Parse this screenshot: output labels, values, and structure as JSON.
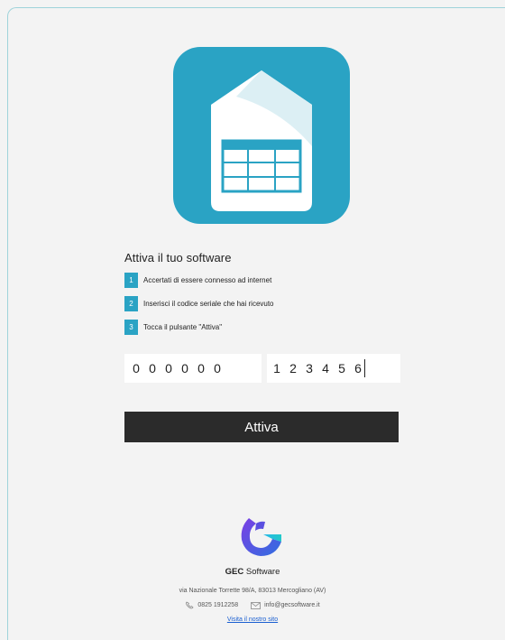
{
  "activation": {
    "title": "Attiva il tuo software",
    "steps": [
      {
        "number": "1",
        "text": "Accertati di essere connesso ad internet"
      },
      {
        "number": "2",
        "text": "Inserisci il codice seriale che hai ricevuto"
      },
      {
        "number": "3",
        "text": "Tocca il pulsante \"Attiva\""
      }
    ],
    "serial_first": [
      "0",
      "0",
      "0",
      "0",
      "0",
      "0"
    ],
    "serial_second": [
      "1",
      "2",
      "3",
      "4",
      "5",
      "6"
    ],
    "button_label": "Attiva"
  },
  "colors": {
    "accent": "#2aa3c4",
    "button": "#2b2b2b",
    "background": "#f3f3f3",
    "link": "#1a5fd1"
  },
  "footer": {
    "company_bold": "GEC",
    "company_rest": " Software",
    "address": "via Nazionale Torrette 98/A, 83013 Mercogliano (AV)",
    "phone": "0825 1912258",
    "email": "info@gecsoftware.it",
    "link_label": "Visita il nostro sito",
    "phone_icon": "phone-icon",
    "email_icon": "envelope-icon"
  }
}
